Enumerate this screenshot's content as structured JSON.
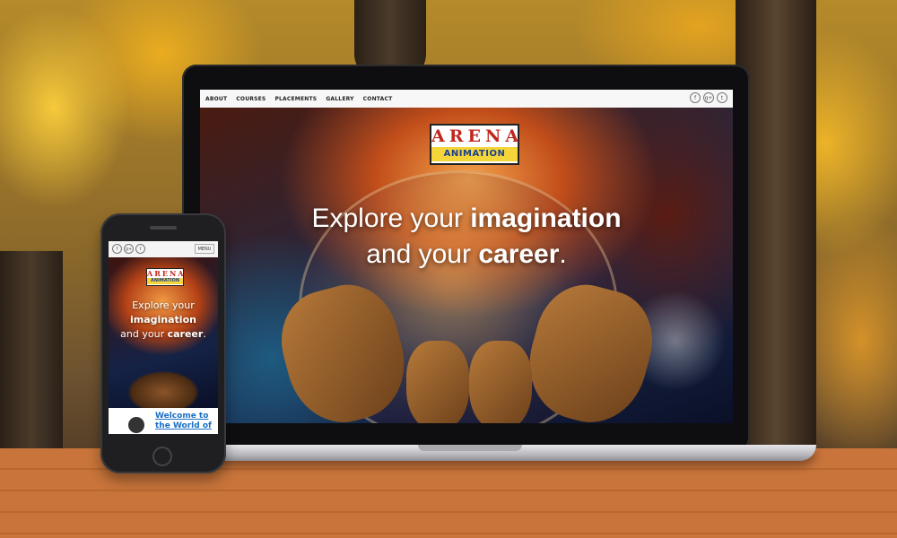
{
  "desktop": {
    "nav": [
      "ABOUT",
      "COURSES",
      "PLACEMENTS",
      "GALLERY",
      "CONTACT"
    ],
    "social": [
      {
        "icon": "facebook-icon",
        "glyph": "f"
      },
      {
        "icon": "google-plus-icon",
        "glyph": "g+"
      },
      {
        "icon": "twitter-icon",
        "glyph": "t"
      }
    ],
    "logo": {
      "top": "ARENA",
      "bottom": "ANIMATION"
    },
    "headline": {
      "line1_plain": "Explore your ",
      "line1_bold": "imagination",
      "line2_plain": "and your ",
      "line2_bold": "career",
      "line2_end": "."
    }
  },
  "mobile": {
    "social": [
      {
        "icon": "facebook-icon",
        "glyph": "f"
      },
      {
        "icon": "google-plus-icon",
        "glyph": "g+"
      },
      {
        "icon": "twitter-icon",
        "glyph": "t"
      }
    ],
    "menu_label": "MENU",
    "logo": {
      "top": "ARENA",
      "bottom": "ANIMATION"
    },
    "headline": {
      "line1": "Explore your",
      "line2_bold": "imagination",
      "line3_plain": "and your ",
      "line3_bold": "career",
      "line3_end": "."
    },
    "welcome_text": "Welcome to the World of"
  }
}
